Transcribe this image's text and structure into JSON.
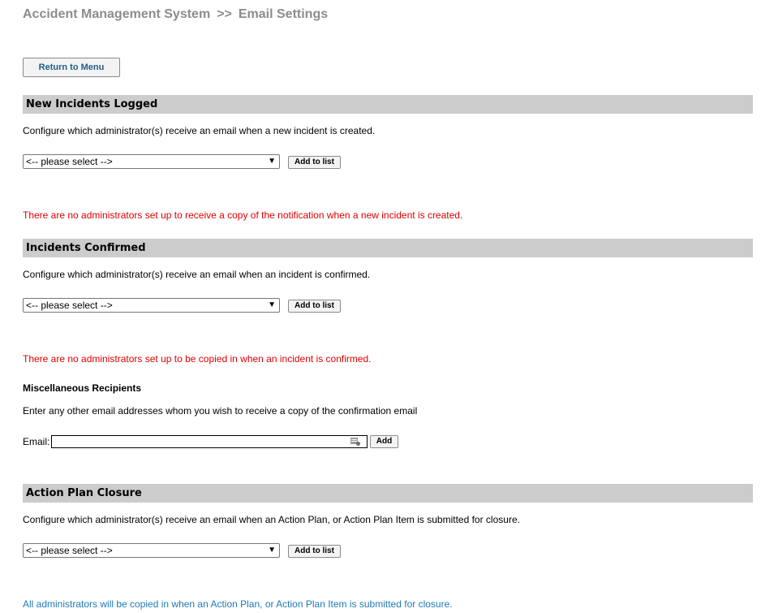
{
  "header": {
    "app_name": "Accident Management System",
    "separator": ">>",
    "page_name": "Email Settings"
  },
  "return_button": "Return to Menu",
  "sections": {
    "new_incidents": {
      "title": "New Incidents Logged",
      "description": "Configure which administrator(s) receive an email when a new incident is created.",
      "select_value": "<-- please select -->",
      "add_button": "Add to list",
      "notice": "There are no administrators set up to receive a copy of the notification when a new incident is created."
    },
    "incidents_confirmed": {
      "title": "Incidents Confirmed",
      "description": "Configure which administrator(s) receive an email when an incident is confirmed.",
      "select_value": "<-- please select -->",
      "add_button": "Add to list",
      "notice": "There are no administrators set up to be copied in when an incident is confirmed."
    },
    "misc_recipients": {
      "title": "Miscellaneous Recipients",
      "description": "Enter any other email addresses whom you wish to receive a copy of the confirmation email",
      "email_label": "Email:",
      "email_value": "",
      "add_button": "Add"
    },
    "action_plan": {
      "title": "Action Plan Closure",
      "description": "Configure which administrator(s) receive an email when an Action Plan, or Action Plan Item is submitted for closure.",
      "select_value": "<-- please select -->",
      "add_button": "Add to list",
      "notice": "All administrators will be copied in when an Action Plan, or Action Plan Item is submitted for closure."
    }
  },
  "colors": {
    "title_gray": "#8c8c8c",
    "section_bar": "#cccccc",
    "error_red": "#e00000",
    "info_blue": "#1f7ab4",
    "menu_button_text": "#1f5f8b"
  },
  "icons": {
    "dropdown": "chevron-down-icon",
    "email_field_badge": "password-manager-icon"
  }
}
